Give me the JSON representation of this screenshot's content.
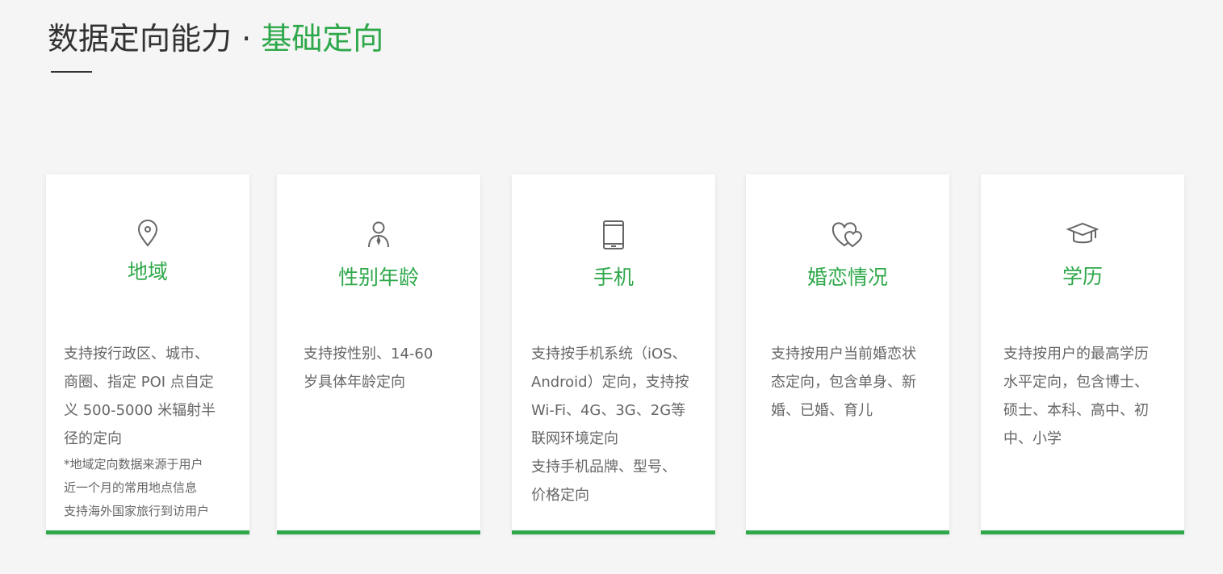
{
  "header": {
    "title_main": "数据定向能力",
    "title_separator": "·",
    "title_accent": "基础定向"
  },
  "colors": {
    "accent": "#2ea84a",
    "text_dark": "#333333",
    "text_body": "#666666",
    "background": "#f5f5f5",
    "card": "#ffffff"
  },
  "cards": [
    {
      "icon": "location-pin-icon",
      "title": "地域",
      "lines": [
        "支持按行政区、城市、",
        "商圈、指定 POI 点自定",
        "义 500-5000 米辐射半",
        "径的定向"
      ],
      "notes": [
        "*地域定向数据来源于用户",
        "近一个月的常用地点信息",
        "支持海外国家旅行到访用户"
      ]
    },
    {
      "icon": "person-icon",
      "title": "性别年龄",
      "lines": [
        "支持按性别、14-60",
        "岁具体年龄定向"
      ],
      "notes": []
    },
    {
      "icon": "mobile-phone-icon",
      "title": "手机",
      "lines": [
        "支持按手机系统（iOS、",
        "Android）定向，支持按",
        "Wi-Fi、4G、3G、2G等",
        "联网环境定向",
        "支持手机品牌、型号、",
        "价格定向"
      ],
      "notes": []
    },
    {
      "icon": "double-heart-icon",
      "title": "婚恋情况",
      "lines": [
        "支持按用户当前婚恋状",
        "态定向，包含单身、新",
        "婚、已婚、育儿"
      ],
      "notes": []
    },
    {
      "icon": "graduation-cap-icon",
      "title": "学历",
      "lines": [
        "支持按用户的最高学历",
        "水平定向，包含博士、",
        "硕士、本科、高中、初",
        "中、小学"
      ],
      "notes": []
    }
  ]
}
